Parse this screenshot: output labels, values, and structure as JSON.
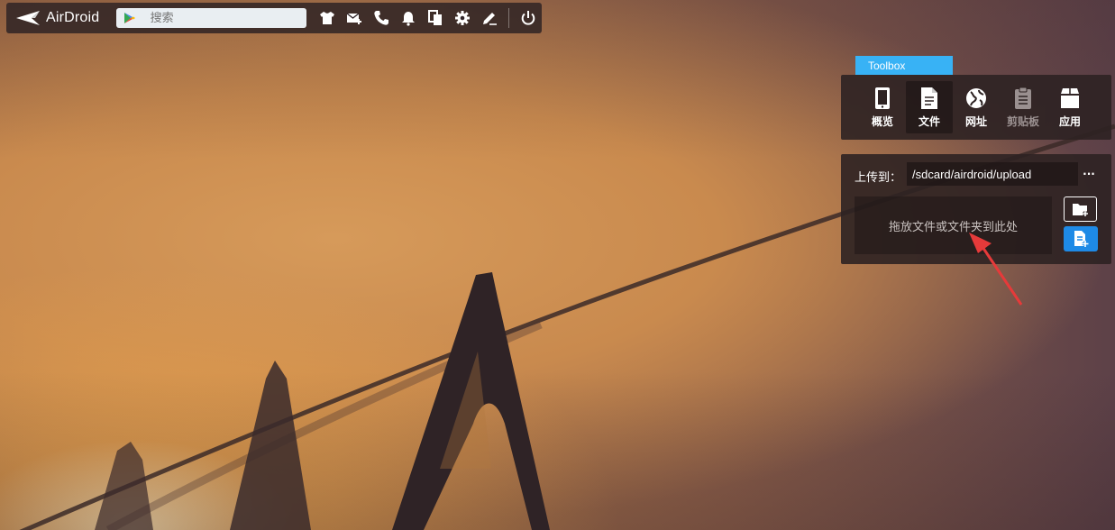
{
  "app": {
    "name": "AirDroid"
  },
  "search": {
    "placeholder": "搜索"
  },
  "topbar_icons": [
    "shirt-icon",
    "mail-add-icon",
    "phone-icon",
    "bell-icon",
    "copy-icon",
    "gear-icon",
    "pen-icon",
    "power-icon"
  ],
  "toolbox": {
    "tab_label": "Toolbox",
    "items": [
      {
        "label": "概览",
        "icon": "phone-device-icon",
        "active": false,
        "disabled": false
      },
      {
        "label": "文件",
        "icon": "file-icon",
        "active": true,
        "disabled": false
      },
      {
        "label": "网址",
        "icon": "globe-icon",
        "active": false,
        "disabled": false
      },
      {
        "label": "剪贴板",
        "icon": "clipboard-icon",
        "active": false,
        "disabled": true
      },
      {
        "label": "应用",
        "icon": "apps-icon",
        "active": false,
        "disabled": false
      }
    ]
  },
  "upload": {
    "label": "上传到：",
    "path": "/sdcard/airdroid/upload",
    "more": "···",
    "drop_text": "拖放文件或文件夹到此处"
  },
  "colors": {
    "accent": "#38b2f5",
    "button_blue": "#1e8ae6",
    "annotation_arrow": "#e63a3a"
  }
}
